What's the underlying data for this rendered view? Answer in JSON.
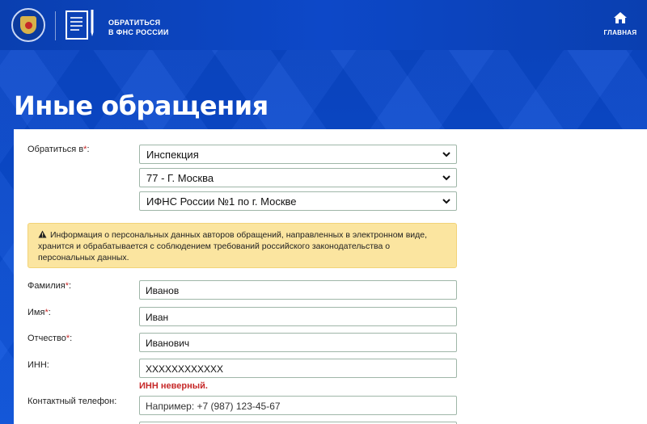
{
  "header": {
    "title_line1": "ОБРАТИТЬСЯ",
    "title_line2": "В ФНС РОССИИ",
    "home_label": "ГЛАВНАЯ"
  },
  "page": {
    "title": "Иные обращения"
  },
  "form": {
    "recipient": {
      "label": "Обратиться в",
      "required_mark": "*",
      "colon": ":",
      "type_value": "Инспекция",
      "region_value": "77 - Г. Москва",
      "office_value": "ИФНС России №1 по г. Москве"
    },
    "notice": {
      "icon": "warning-icon",
      "text": "Информация о персональных данных авторов обращений, направленных в электронном виде, хранится и обрабатывается с соблюдением требований российского законодательства о персональных данных."
    },
    "last_name": {
      "label": "Фамилия",
      "required_mark": "*",
      "colon": ":",
      "value": "Иванов"
    },
    "first_name": {
      "label": "Имя",
      "required_mark": "*",
      "colon": ":",
      "value": "Иван"
    },
    "middle_name": {
      "label": "Отчество",
      "required_mark": "*",
      "colon": ":",
      "value": "Иванович"
    },
    "inn": {
      "label": "ИНН:",
      "value": "XXXXXXXXXXXX",
      "error": "ИНН неверный."
    },
    "phone": {
      "label": "Контактный телефон:",
      "placeholder": "Например: +7 (987) 123-45-67"
    }
  }
}
